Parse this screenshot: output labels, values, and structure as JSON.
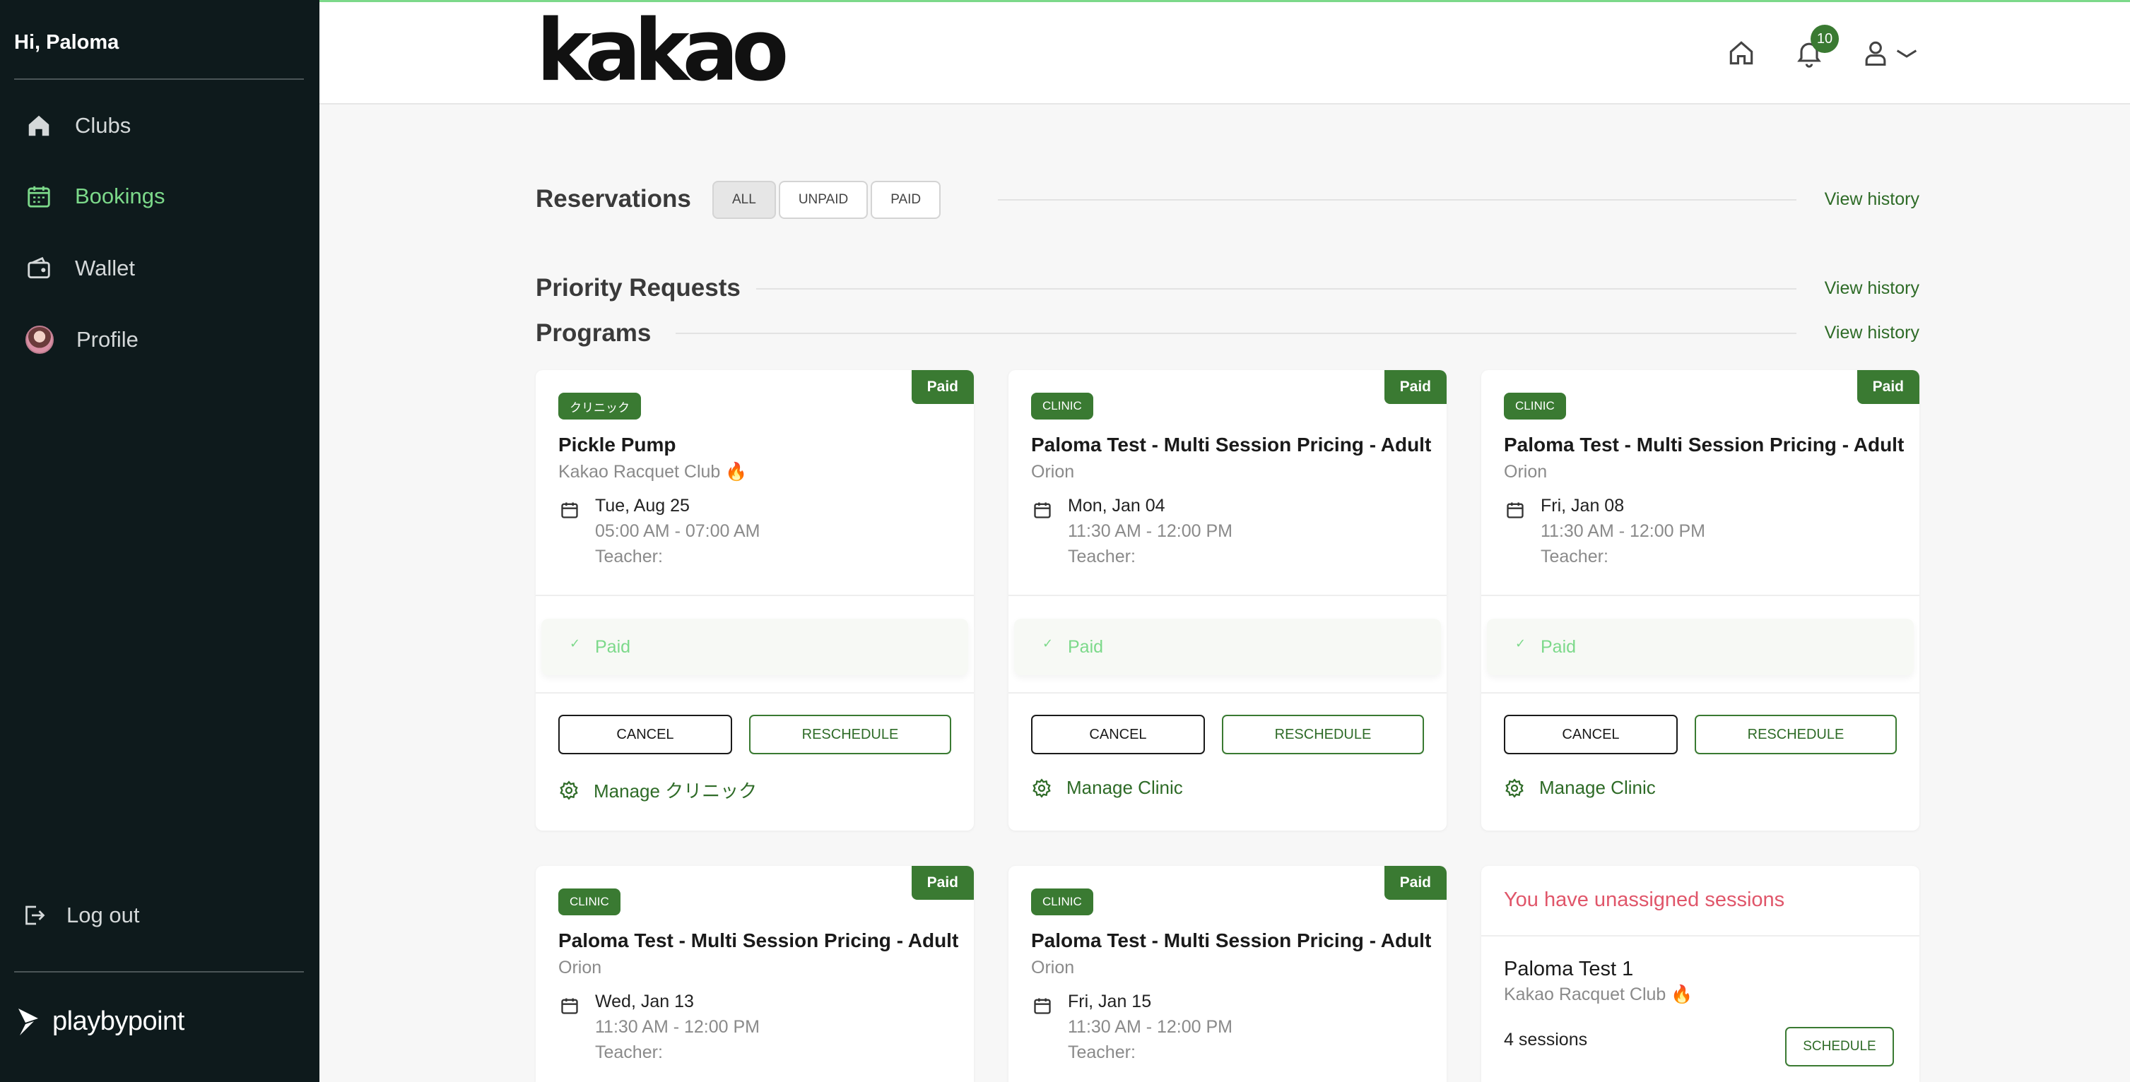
{
  "sidebar": {
    "greeting": "Hi, Paloma",
    "items": [
      {
        "label": "Clubs",
        "icon": "home-icon"
      },
      {
        "label": "Bookings",
        "icon": "calendar-icon",
        "active": true
      },
      {
        "label": "Wallet",
        "icon": "wallet-icon"
      },
      {
        "label": "Profile",
        "icon": "avatar"
      }
    ],
    "logout": "Log out",
    "brand": "playbypoint"
  },
  "header": {
    "logo": "kakao",
    "notifications_count": "10",
    "icons": [
      "home-icon",
      "bell-icon",
      "user-icon",
      "chevron-down-icon"
    ]
  },
  "reservations": {
    "title": "Reservations",
    "filters": [
      "ALL",
      "UNPAID",
      "PAID"
    ],
    "active_filter": "ALL",
    "view_history": "View history"
  },
  "priority": {
    "title": "Priority Requests",
    "view_history": "View history"
  },
  "programs": {
    "title": "Programs",
    "view_history": "View history",
    "cards": [
      {
        "paid_tag": "Paid",
        "badge": "クリニック",
        "title": "Pickle Pump",
        "club": "Kakao Racquet Club 🔥",
        "date": "Tue, Aug 25",
        "time": "05:00 AM - 07:00 AM",
        "teacher": "Teacher:",
        "status": "Paid",
        "cancel": "CANCEL",
        "reschedule": "RESCHEDULE",
        "manage": "Manage クリニック"
      },
      {
        "paid_tag": "Paid",
        "badge": "CLINIC",
        "title": "Paloma Test - Multi Session Pricing - Adult",
        "club": "Orion",
        "date": "Mon, Jan 04",
        "time": "11:30 AM - 12:00 PM",
        "teacher": "Teacher:",
        "status": "Paid",
        "cancel": "CANCEL",
        "reschedule": "RESCHEDULE",
        "manage": "Manage Clinic"
      },
      {
        "paid_tag": "Paid",
        "badge": "CLINIC",
        "title": "Paloma Test - Multi Session Pricing - Adult",
        "club": "Orion",
        "date": "Fri, Jan 08",
        "time": "11:30 AM - 12:00 PM",
        "teacher": "Teacher:",
        "status": "Paid",
        "cancel": "CANCEL",
        "reschedule": "RESCHEDULE",
        "manage": "Manage Clinic"
      },
      {
        "paid_tag": "Paid",
        "badge": "CLINIC",
        "title": "Paloma Test - Multi Session Pricing - Adult",
        "club": "Orion",
        "date": "Wed, Jan 13",
        "time": "11:30 AM - 12:00 PM",
        "teacher": "Teacher:"
      },
      {
        "paid_tag": "Paid",
        "badge": "CLINIC",
        "title": "Paloma Test - Multi Session Pricing - Adult",
        "club": "Orion",
        "date": "Fri, Jan 15",
        "time": "11:30 AM - 12:00 PM",
        "teacher": "Teacher:"
      }
    ],
    "unassigned": {
      "title": "You have unassigned sessions",
      "name": "Paloma Test 1",
      "club": "Kakao Racquet Club 🔥",
      "sessions": "4 sessions",
      "schedule": "SCHEDULE"
    }
  },
  "colors": {
    "accent": "#7cd98a",
    "brand_green": "#3a7a32",
    "sidebar_bg": "#0e1a1c",
    "alert": "#e0566a"
  }
}
